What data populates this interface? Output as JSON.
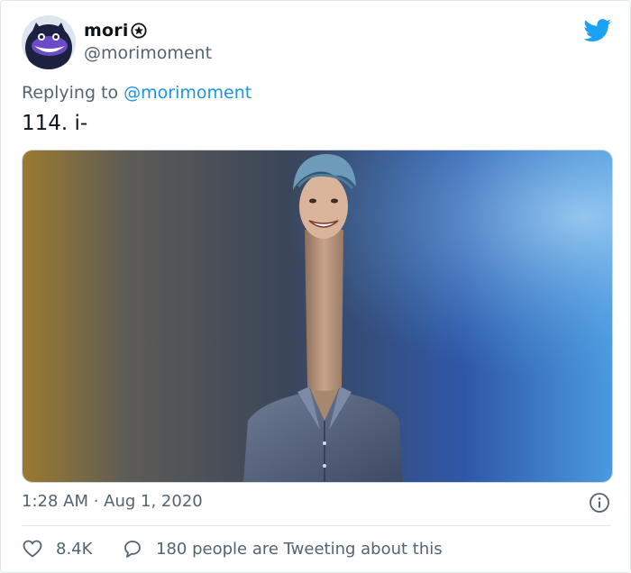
{
  "author": {
    "display_name": "mori",
    "handle": "@morimoment",
    "badge_icon": "star-badge-icon",
    "avatar_icon": "cartoon-cat-avatar"
  },
  "reply": {
    "prefix": "Replying to",
    "handle": "@morimoment"
  },
  "tweet": {
    "text": "114. i-",
    "media": "photo-of-smiling-man-with-stretched-neck"
  },
  "meta": {
    "timestamp": "1:28 AM · Aug 1, 2020"
  },
  "actions": {
    "likes": "8.4K",
    "replies_text": "180 people are Tweeting about this"
  },
  "colors": {
    "brand_blue": "#1da1f2",
    "link_blue": "#1b95e0",
    "secondary_text": "#536471",
    "divider": "#e1e8ed"
  }
}
